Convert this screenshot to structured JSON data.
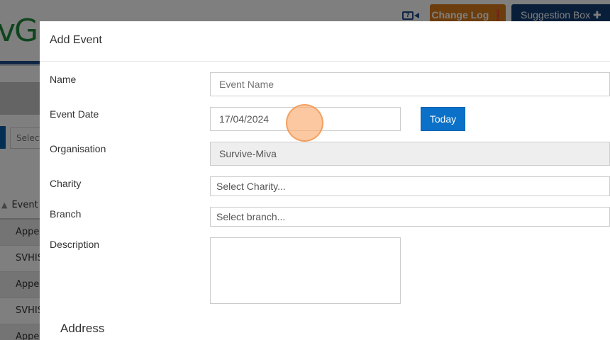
{
  "background": {
    "logo_text": "vG",
    "select_placeholder": "Select",
    "table_header": "Event",
    "table_rows": [
      "Appea",
      "SVHIS",
      "Appea",
      "SVHIS",
      "Appea"
    ],
    "changelog_label": "Change Log ❗",
    "suggestion_label": "Suggestion Box ✚",
    "video_icon_text": "?",
    "brand_color": "#1f8a3a",
    "primary_color": "#0a70c8",
    "warning_color": "#d97a1a"
  },
  "modal": {
    "title": "Add Event",
    "fields": {
      "name": {
        "label": "Name",
        "placeholder": "Event Name",
        "value": ""
      },
      "event_date": {
        "label": "Event Date",
        "value": "17/04/2024",
        "button": "Today"
      },
      "organisation": {
        "label": "Organisation",
        "value": "Survive-Miva"
      },
      "charity": {
        "label": "Charity",
        "value": "Select Charity..."
      },
      "branch": {
        "label": "Branch",
        "value": "Select branch..."
      },
      "description": {
        "label": "Description",
        "value": ""
      }
    },
    "address_heading": "Address"
  }
}
